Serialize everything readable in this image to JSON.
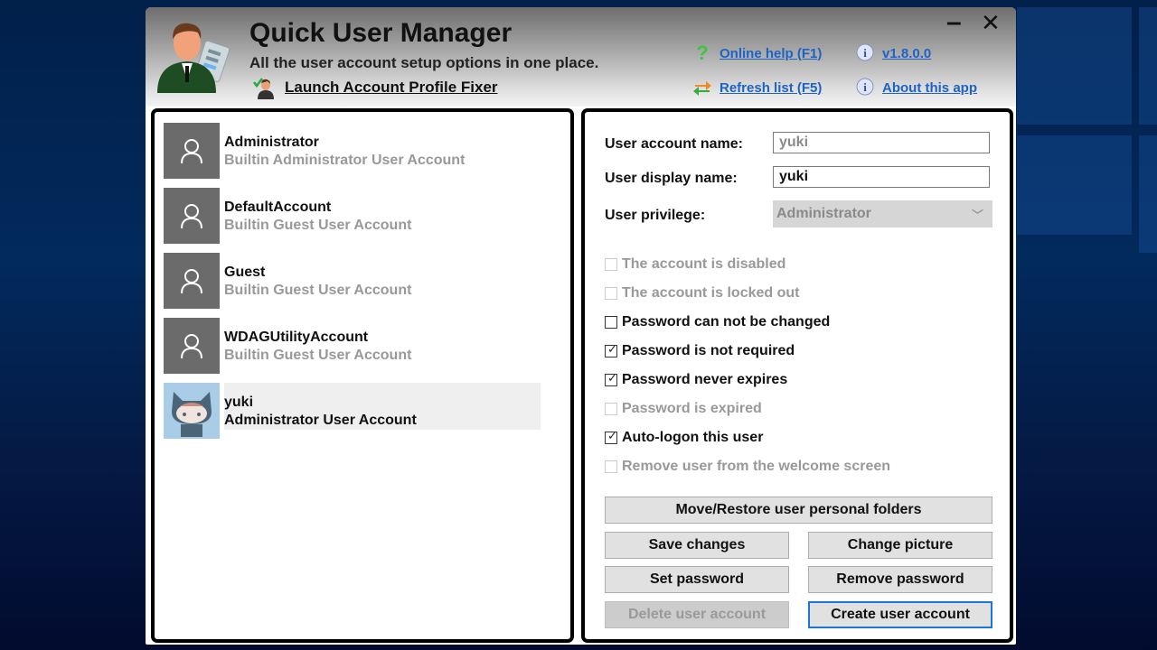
{
  "app": {
    "title": "Quick User Manager",
    "subtitle": "All the user account setup options in one place.",
    "launch_fixer": "Launch Account Profile Fixer",
    "links": {
      "online_help": "Online help (F1)",
      "version": "v1.8.0.0",
      "refresh": "Refresh list (F5)",
      "about": "About this app"
    },
    "window_controls": {
      "minimize": "–",
      "close": "✕"
    }
  },
  "users": [
    {
      "name": "Administrator",
      "description": "Builtin Administrator User Account",
      "avatar": "default-user-icon",
      "selected": false
    },
    {
      "name": "DefaultAccount",
      "description": "Builtin Guest User Account",
      "avatar": "default-user-icon",
      "selected": false
    },
    {
      "name": "Guest",
      "description": "Builtin Guest User Account",
      "avatar": "default-user-icon",
      "selected": false
    },
    {
      "name": "WDAGUtilityAccount",
      "description": "Builtin Guest User Account",
      "avatar": "default-user-icon",
      "selected": false
    },
    {
      "name": "yuki",
      "description": "Administrator User Account",
      "avatar": "octocat-icon",
      "selected": true
    }
  ],
  "form": {
    "account_name_label": "User account name:",
    "account_name_value": "yuki",
    "display_name_label": "User display name:",
    "display_name_value": "yuki",
    "privilege_label": "User privilege:",
    "privilege_value": "Administrator"
  },
  "options": [
    {
      "label": "The account is disabled",
      "checked": false,
      "enabled": false
    },
    {
      "label": "The account is locked out",
      "checked": false,
      "enabled": false
    },
    {
      "label": "Password can not be changed",
      "checked": false,
      "enabled": true
    },
    {
      "label": "Password is not required",
      "checked": true,
      "enabled": true
    },
    {
      "label": "Password never expires",
      "checked": true,
      "enabled": true
    },
    {
      "label": "Password is expired",
      "checked": false,
      "enabled": false
    },
    {
      "label": "Auto-logon this user",
      "checked": true,
      "enabled": true
    },
    {
      "label": "Remove user from the welcome screen",
      "checked": false,
      "enabled": false
    }
  ],
  "buttons": {
    "move_restore": "Move/Restore user personal folders",
    "save_changes": "Save changes",
    "change_picture": "Change picture",
    "set_password": "Set password",
    "remove_password": "Remove password",
    "delete_account": "Delete user account",
    "create_account": "Create user account"
  }
}
